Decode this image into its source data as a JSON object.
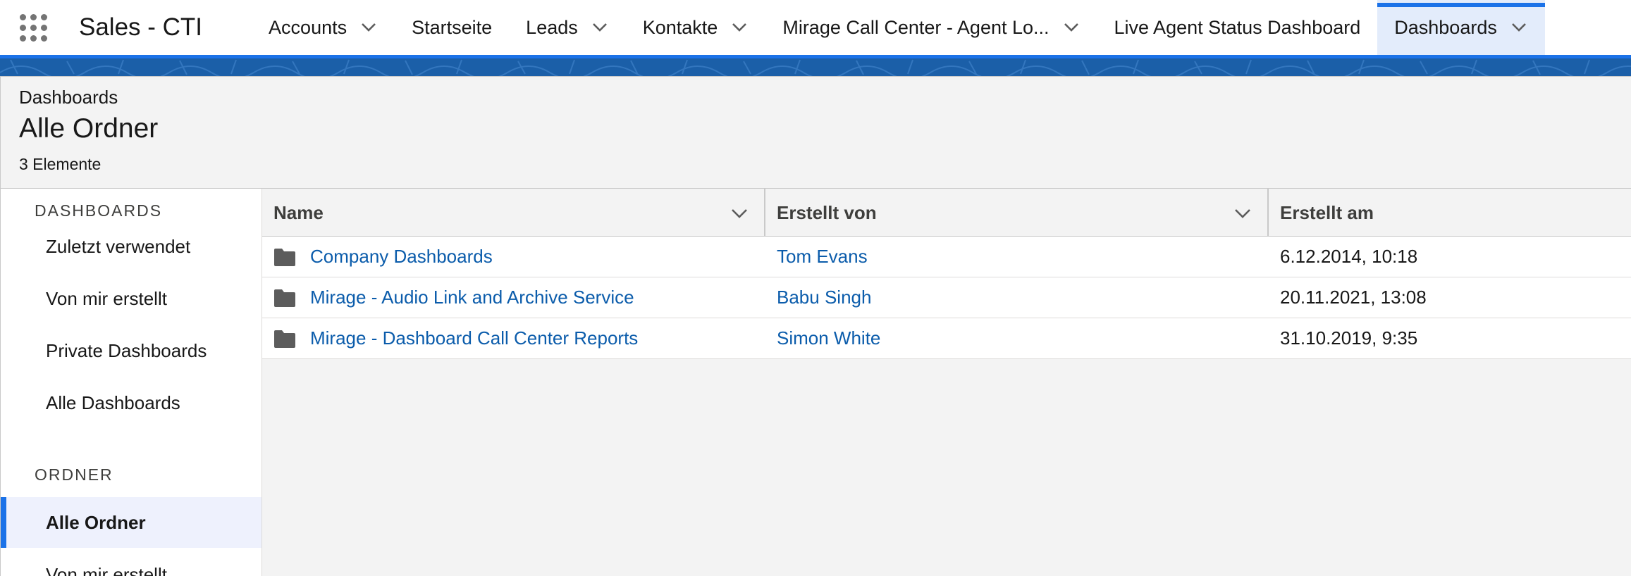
{
  "app": {
    "name": "Sales - CTI"
  },
  "nav": {
    "tabs": [
      {
        "label": "Accounts",
        "has_menu": true,
        "active": false
      },
      {
        "label": "Startseite",
        "has_menu": false,
        "active": false
      },
      {
        "label": "Leads",
        "has_menu": true,
        "active": false
      },
      {
        "label": "Kontakte",
        "has_menu": true,
        "active": false
      },
      {
        "label": "Mirage Call Center - Agent Lo...",
        "has_menu": true,
        "active": false
      },
      {
        "label": "Live Agent Status Dashboard",
        "has_menu": false,
        "active": false
      },
      {
        "label": "Dashboards",
        "has_menu": true,
        "active": true
      }
    ]
  },
  "header": {
    "breadcrumb": "Dashboards",
    "title": "Alle Ordner",
    "count": "3 Elemente"
  },
  "sidebar": {
    "dashboards_heading": "DASHBOARDS",
    "dashboards_items": [
      {
        "label": "Zuletzt verwendet"
      },
      {
        "label": "Von mir erstellt"
      },
      {
        "label": "Private Dashboards"
      },
      {
        "label": "Alle Dashboards"
      }
    ],
    "folders_heading": "ORDNER",
    "folders_items": [
      {
        "label": "Alle Ordner",
        "selected": true
      },
      {
        "label": "Von mir erstellt",
        "selected": false
      }
    ]
  },
  "table": {
    "columns": [
      "Name",
      "Erstellt von",
      "Erstellt am"
    ],
    "rows": [
      {
        "name": "Company Dashboards",
        "created_by": "Tom Evans",
        "created_at": "6.12.2014, 10:18"
      },
      {
        "name": "Mirage - Audio Link and Archive Service",
        "created_by": "Babu Singh",
        "created_at": "20.11.2021, 13:08"
      },
      {
        "name": "Mirage - Dashboard Call Center Reports",
        "created_by": "Simon White",
        "created_at": "31.10.2019, 9:35"
      }
    ]
  },
  "colors": {
    "accent": "#1b72e8",
    "link": "#0b5cab",
    "brand_band": "#1b5fa8",
    "active_tab_bg": "#e3ecfb",
    "selected_item_bg": "#eef1fd",
    "folder_icon": "#5c5c5c"
  },
  "icons": {
    "app_launcher": "waffle-icon",
    "tab_menu": "chevron-down-icon",
    "column_menu": "chevron-down-icon",
    "row": "folder-icon"
  }
}
